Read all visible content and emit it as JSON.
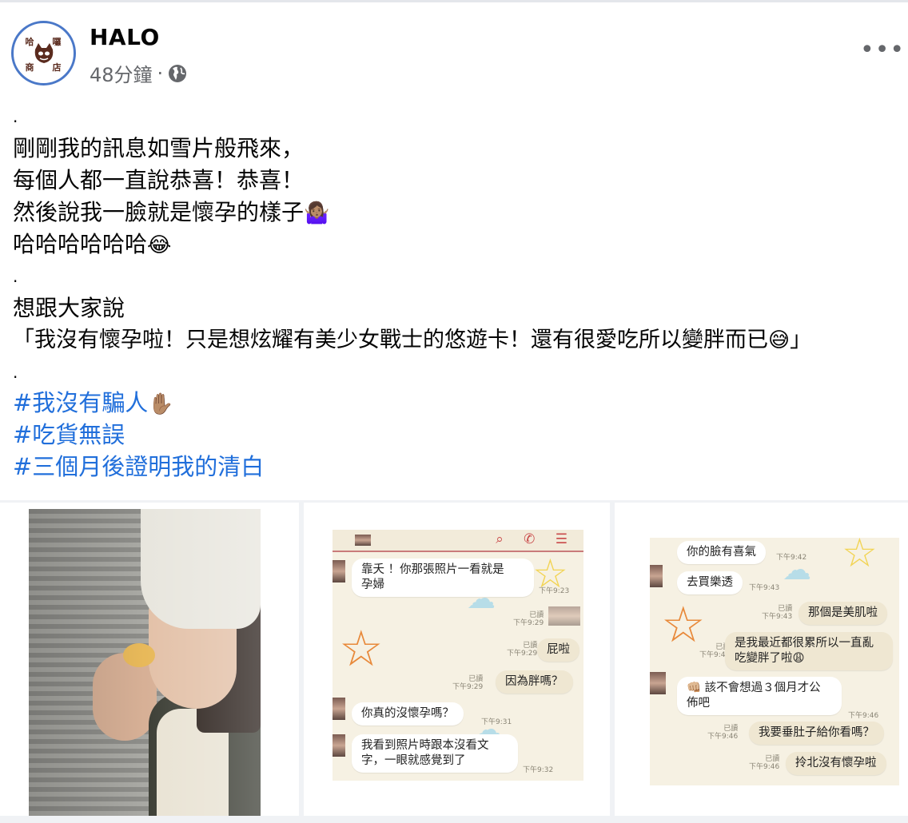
{
  "post": {
    "author": "HALO",
    "time": "48分鐘",
    "separator": "·",
    "privacy_icon": "globe-icon",
    "more_icon": "more-options-icon",
    "more_glyph": "•••",
    "avatar": {
      "icon": "cat-logo-icon",
      "text_top_left": "哈",
      "text_top_right": "囉",
      "text_bottom_left": "商",
      "text_bottom_right": "店"
    },
    "lines": [
      {
        "text": ".",
        "emoji": ""
      },
      {
        "text": "剛剛我的訊息如雪片般飛來，",
        "emoji": ""
      },
      {
        "text": "每個人都一直說恭喜！恭喜！",
        "emoji": ""
      },
      {
        "text": "然後說我一臉就是懷孕的樣子",
        "emoji": "🤷🏽‍♀️"
      },
      {
        "text": "哈哈哈哈哈哈",
        "emoji": "😂"
      },
      {
        "text": ".",
        "emoji": ""
      },
      {
        "text": "想跟大家說",
        "emoji": ""
      },
      {
        "text": "「我沒有懷孕啦！只是想炫耀有美少女戰士的悠遊卡！還有很愛吃所以變胖而已",
        "emoji": "😅",
        "after": "」"
      },
      {
        "text": ".",
        "emoji": ""
      }
    ],
    "hashtags": [
      {
        "text": "#我沒有騙人",
        "emoji": "✋🏽"
      },
      {
        "text": "#吃貨無誤",
        "emoji": ""
      },
      {
        "text": "#三個月後證明我的清白",
        "emoji": ""
      }
    ]
  },
  "chat2": {
    "icons": "⌕ ✆ ☰",
    "messages": [
      {
        "text": "靠夭 ！你那張照片一看就是\n孕婦",
        "time": "下午9:23",
        "read": ""
      },
      {
        "text": "",
        "time": "下午9:29",
        "read": "已讀"
      },
      {
        "text": "屁啦",
        "time": "下午9:29",
        "read": "已讀"
      },
      {
        "text": "因為胖嗎？",
        "time": "下午9:29",
        "read": "已讀"
      },
      {
        "text": "你真的沒懷孕嗎？",
        "time": "下午9:31",
        "read": ""
      },
      {
        "text": "我看到照片時跟本沒看文\n字，一眼就感覺到了",
        "time": "下午9:32",
        "read": ""
      }
    ]
  },
  "chat3": {
    "messages": [
      {
        "text": "你的臉有喜氣",
        "time": "下午9:42",
        "read": ""
      },
      {
        "text": "去買樂透",
        "time": "下午9:43",
        "read": ""
      },
      {
        "text": "那個是美肌啦",
        "time": "下午9:43",
        "read": "已讀"
      },
      {
        "text": "是我最近都很累所以一直亂\n吃變胖了啦😩",
        "time": "下午9:44",
        "read": "已讀"
      },
      {
        "text": "👊🏼 該不會想過３個月才公\n佈吧",
        "time": "下午9:46",
        "read": ""
      },
      {
        "text": "我要垂肚子給你看嗎？",
        "time": "下午9:46",
        "read": "已讀"
      },
      {
        "text": "拎北沒有懷孕啦",
        "time": "下午9:46",
        "read": "已讀"
      }
    ]
  },
  "colors": {
    "hashtag": "#216fdb",
    "meta": "#65676b",
    "avatar_ring": "#4a78c8"
  }
}
